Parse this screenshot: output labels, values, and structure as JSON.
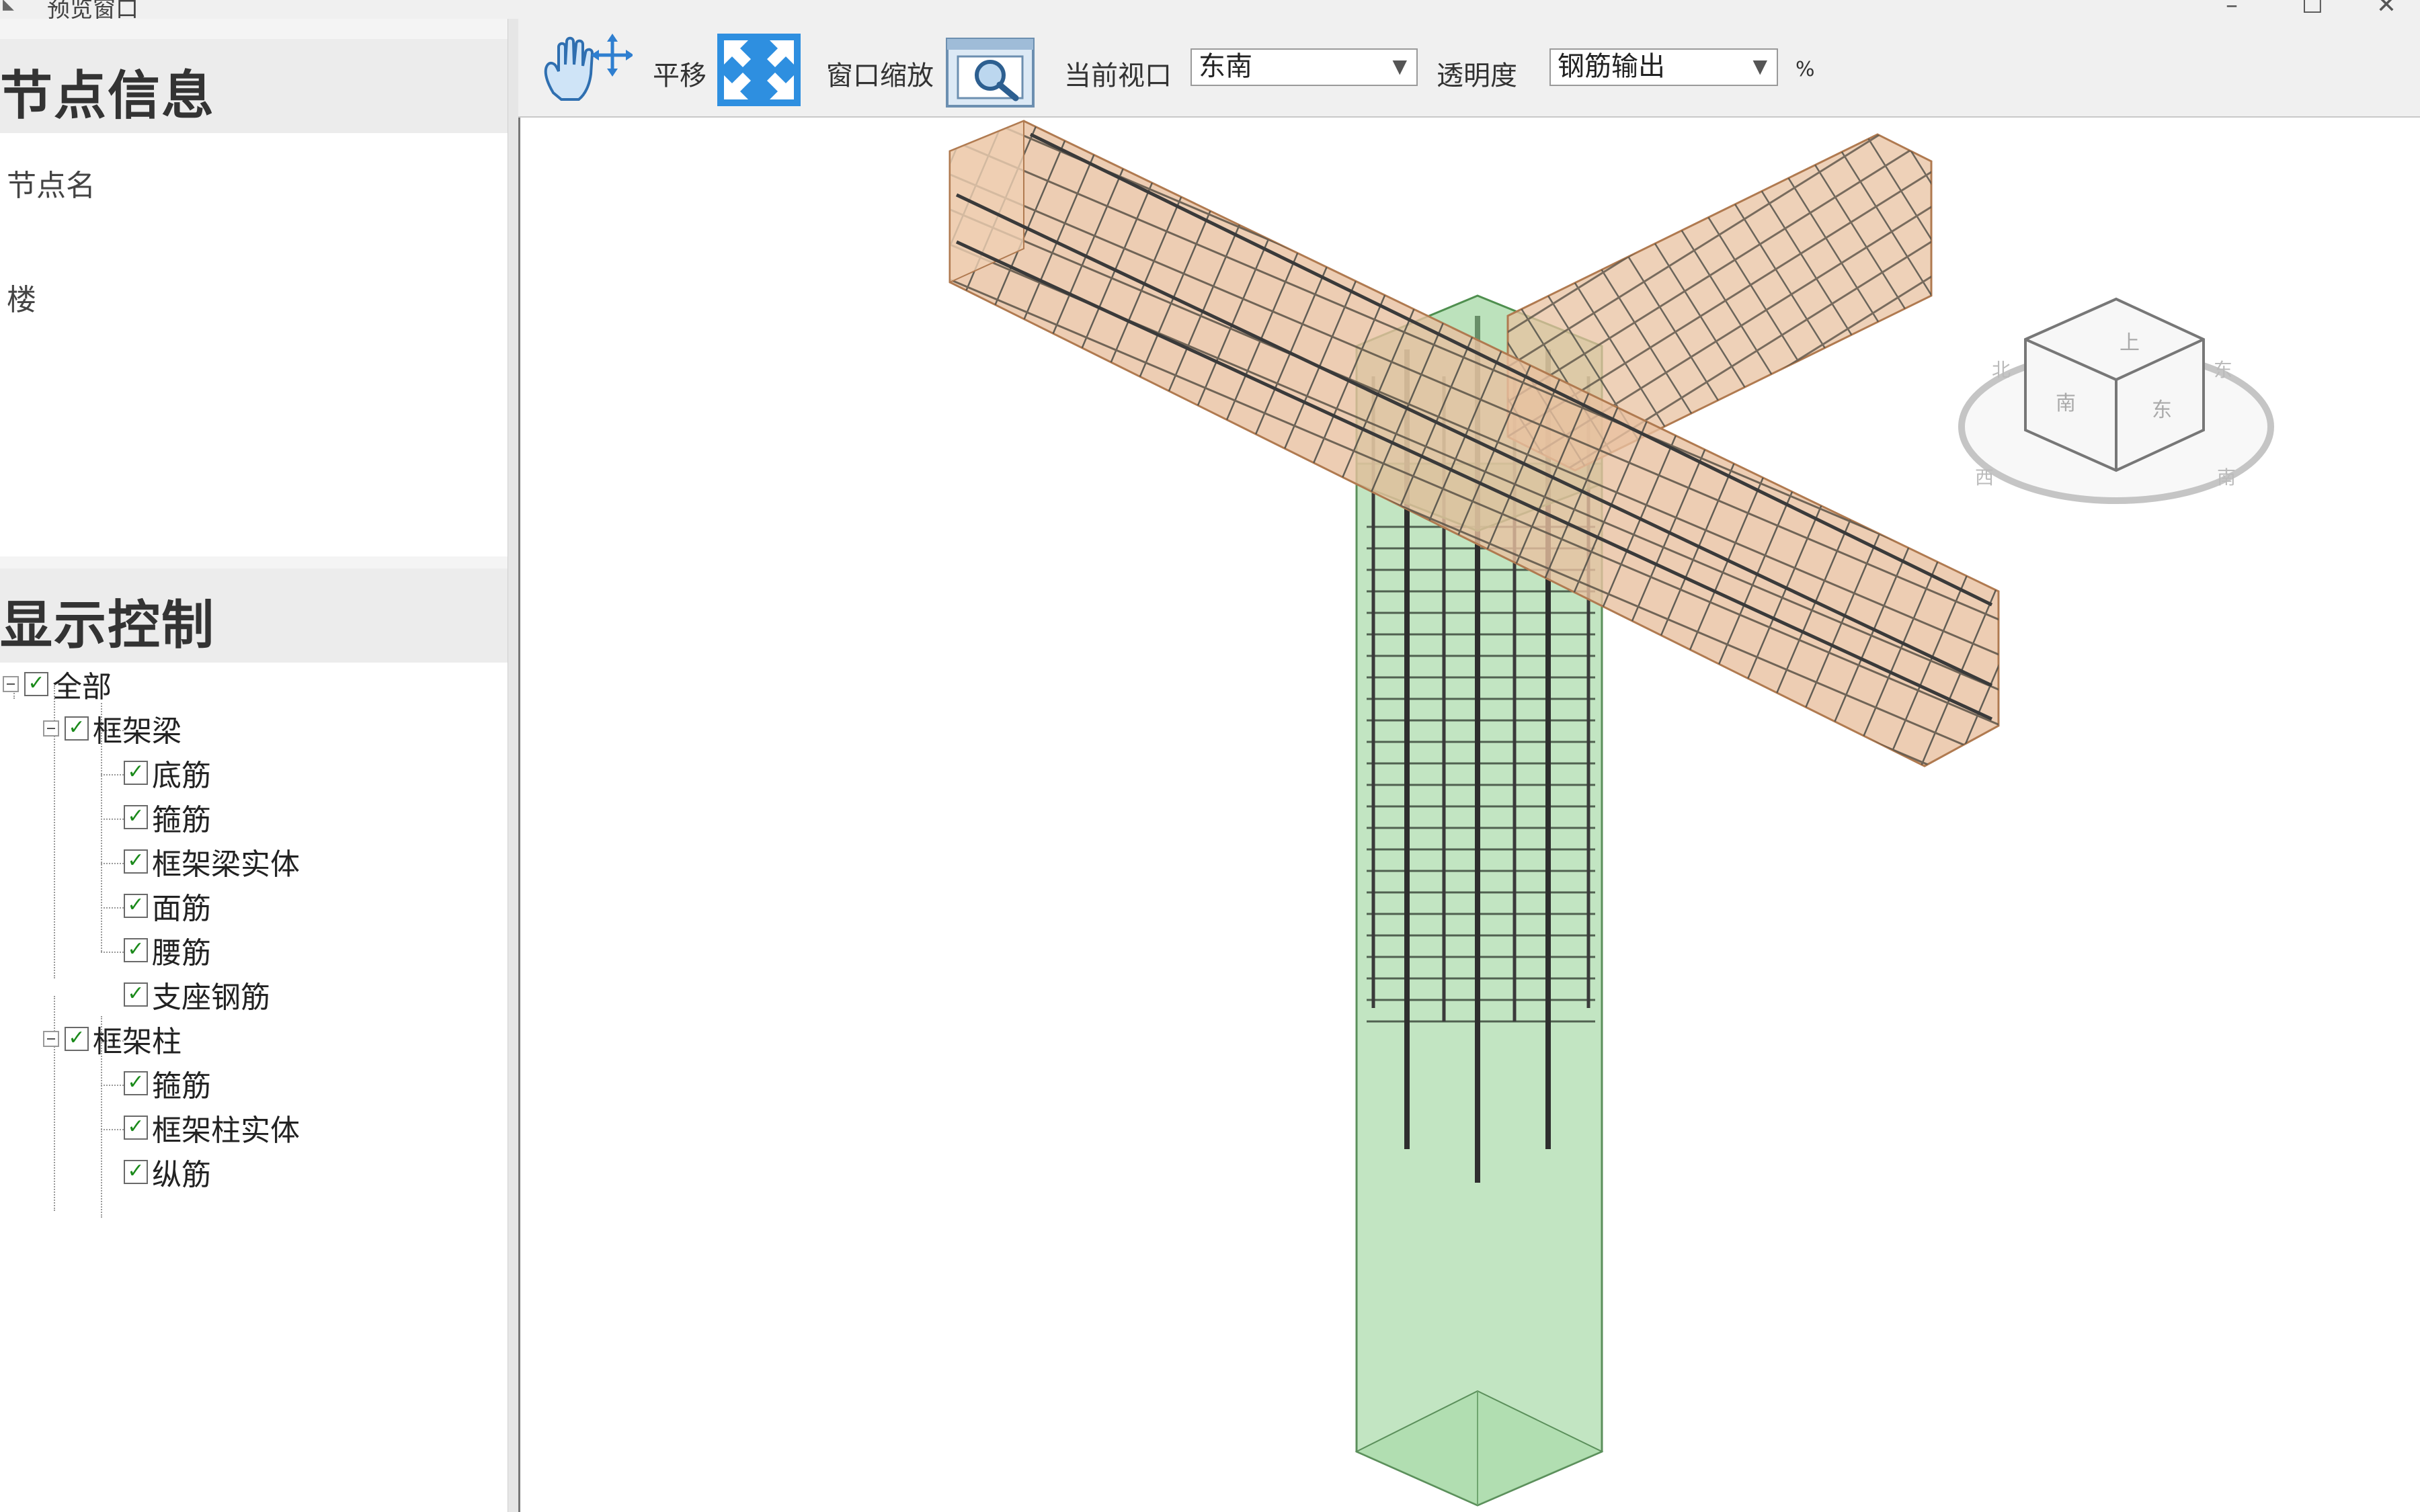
{
  "window": {
    "title": "预览窗口",
    "minimize": "–",
    "maximize": "☐",
    "close": "✕"
  },
  "node_info": {
    "header": "节点信息",
    "node_name_label": "节点名",
    "floor_label": "楼"
  },
  "display_control": {
    "header": "显示控制",
    "tree": [
      {
        "label": "全部",
        "checked": true,
        "level": 0
      },
      {
        "label": "框架梁",
        "checked": true,
        "level": 1
      },
      {
        "label": "底筋",
        "checked": true,
        "level": 2
      },
      {
        "label": "箍筋",
        "checked": true,
        "level": 2
      },
      {
        "label": "框架梁实体",
        "checked": true,
        "level": 2
      },
      {
        "label": "面筋",
        "checked": true,
        "level": 2
      },
      {
        "label": "腰筋",
        "checked": true,
        "level": 2
      },
      {
        "label": "支座钢筋",
        "checked": true,
        "level": 2
      },
      {
        "label": "框架柱",
        "checked": true,
        "level": 1
      },
      {
        "label": "箍筋",
        "checked": true,
        "level": 2
      },
      {
        "label": "框架柱实体",
        "checked": true,
        "level": 2
      },
      {
        "label": "纵筋",
        "checked": true,
        "level": 2
      }
    ]
  },
  "toolbar": {
    "pan_label": "平移",
    "zoom_label": "窗口缩放",
    "view_label": "当前视口",
    "view_value": "东南",
    "transparency_label": "透明度",
    "transparency_value": "钢筋输出",
    "percent": "%",
    "icons": [
      "hand-pan-icon",
      "fit-view-icon",
      "window-zoom-icon",
      "dropdown-arrow-icon"
    ]
  },
  "viewcube": {
    "faces": [
      "上",
      "东",
      "南"
    ],
    "compass": [
      "北",
      "西",
      "东",
      "南"
    ]
  },
  "colors": {
    "beam": "#e8c1a0",
    "column": "#8fcf8f",
    "rebar": "#4a4a44",
    "viewcube": "#bfbfbf"
  }
}
